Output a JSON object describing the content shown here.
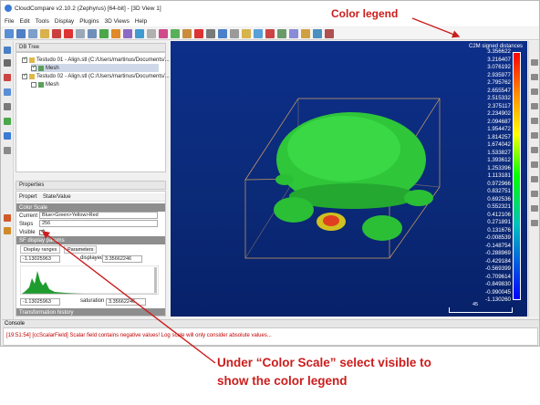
{
  "window": {
    "title": "CloudCompare v2.10.2 (Zephyrus) [64-bit] - [3D View 1]"
  },
  "menu": [
    "File",
    "Edit",
    "Tools",
    "Display",
    "Plugins",
    "3D Views",
    "Help"
  ],
  "db_tree": {
    "header": "DB Tree",
    "items": [
      {
        "label": "Testudo 01 - Align.stl (C:/Users/martinus/Documents/...",
        "checked": true
      },
      {
        "label": "Mesh",
        "checked": true
      },
      {
        "label": "Testudo 02 - Align.stl (C:/Users/martinus/Documents/...",
        "checked": true
      },
      {
        "label": "Mesh",
        "checked": false
      }
    ]
  },
  "properties": {
    "header": "Properties",
    "col_property": "Propert",
    "col_value": "State/Value",
    "section_color_scale": "Color Scale",
    "current_label": "Current",
    "current_value": "Blue>Green>Yellow>Red",
    "steps_label": "Steps",
    "steps_value": "256",
    "visible_label": "Visible",
    "sf_display_section": "SF display params",
    "tab_display_ranges": "Display ranges",
    "tab_parameters": "Parameters",
    "range_min": "-1.13025963",
    "displayed_label": "displayed",
    "displayed_value": "3.35662246",
    "sat_min": "-1.13025963",
    "saturation_label": "saturation",
    "saturation_value": "3.35662246",
    "transform_history": "Transformation history"
  },
  "legend": {
    "title": "C2M signed distances",
    "values": [
      "3.356622",
      "3.216407",
      "3.076192",
      "2.935977",
      "2.795762",
      "2.655547",
      "2.515332",
      "2.375117",
      "2.234902",
      "2.094687",
      "1.954472",
      "1.814257",
      "1.674042",
      "1.533827",
      "1.393612",
      "1.253396",
      "1.113181",
      "0.972966",
      "0.832751",
      "0.692536",
      "0.552321",
      "0.412106",
      "0.271891",
      "0.131676",
      "-0.008539",
      "-0.148754",
      "-0.288969",
      "-0.429184",
      "-0.569399",
      "-0.709614",
      "-0.849830",
      "-0.990045",
      "-1.130260"
    ],
    "scale_label": "45"
  },
  "console": {
    "header": "Console",
    "message": "[19:51:54] [ccScalarField] Scalar field contains negative values! Log scale will only consider absolute values..."
  },
  "annotations": {
    "color_legend": "Color legend",
    "instruction_line1": "Under “Color Scale” select visible to",
    "instruction_line2": "show the color legend"
  },
  "colors": {
    "annotation": "#cc1c1c",
    "view_background": "#0b2a78",
    "mesh": "#2fd63a"
  }
}
